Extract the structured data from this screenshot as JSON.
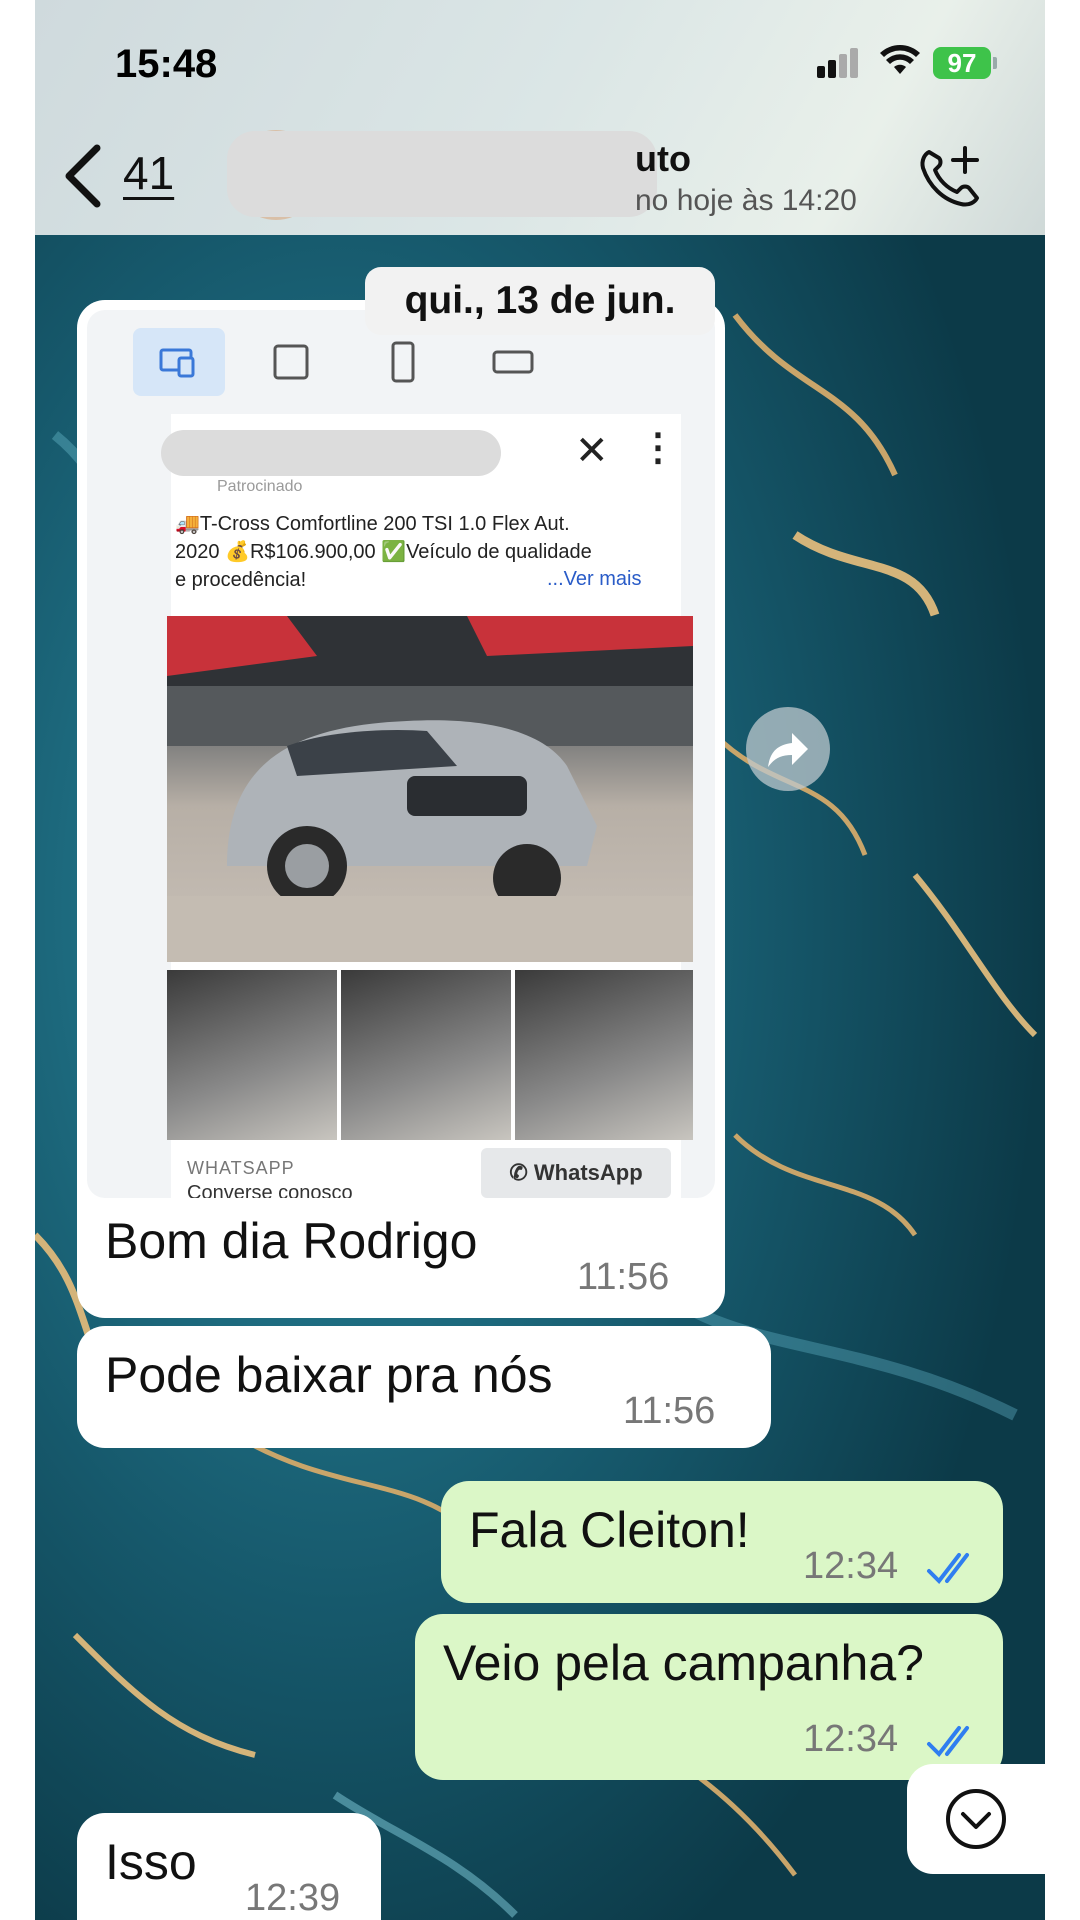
{
  "status_bar": {
    "time": "15:48",
    "battery": "97"
  },
  "header": {
    "back_count": "41",
    "contact_name_suffix": "uto",
    "contact_status": "no hoje às 14:20"
  },
  "chat": {
    "date_label": "qui., 13 de jun.",
    "shared_post": {
      "sponsored_label": "Patrocinado",
      "text": "🚚T-Cross Comfortline 200 TSI 1.0 Flex Aut.\n2020 💰R$106.900,00 ✅Veículo de qualidade\ne procedência!",
      "see_more": "...Ver mais",
      "footer_label": "WHATSAPP",
      "footer_sub": "Converse conosco",
      "whatsapp_button": "WhatsApp"
    },
    "messages": [
      {
        "direction": "in",
        "text": "Bom dia Rodrigo",
        "time": "11:56"
      },
      {
        "direction": "in",
        "text": "Pode baixar pra nós",
        "time": "11:56"
      },
      {
        "direction": "out",
        "text": "Fala Cleiton!",
        "time": "12:34",
        "read": true
      },
      {
        "direction": "out",
        "text": "Veio pela campanha?",
        "time": "12:34",
        "read": true
      },
      {
        "direction": "in",
        "text": "Isso",
        "time": "12:39"
      }
    ]
  },
  "colors": {
    "outgoing_bubble": "#dbf7c7",
    "incoming_bubble": "#ffffff",
    "read_ticks": "#2f7ef0",
    "chat_wallpaper": "#1b6a7d"
  },
  "icons": [
    "back-chevron-icon",
    "add-call-icon",
    "forward-icon",
    "scroll-down-icon",
    "whatsapp-icon"
  ]
}
